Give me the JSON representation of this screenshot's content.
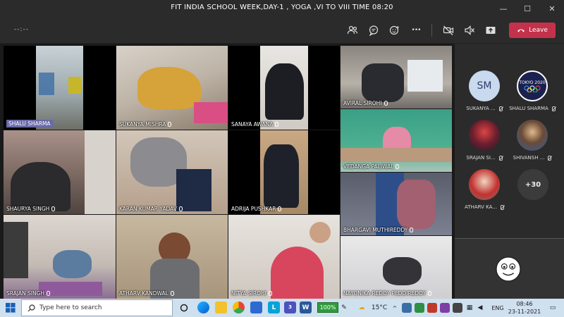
{
  "window": {
    "title": "FIT INDIA SCHOOL WEEK,DAY-1 , YOGA ,VI TO VIII TIME 08:20",
    "minimize_glyph": "—",
    "maximize_glyph": "☐",
    "close_glyph": "✕"
  },
  "toolbar": {
    "timer": "--:--",
    "leave_label": "Leave",
    "more_glyph": "•••",
    "icons": [
      "people-icon",
      "chat-icon",
      "reactions-icon",
      "more-icon",
      "camera-off-icon",
      "mic-off-icon",
      "share-icon",
      "phone-icon"
    ],
    "leave_color": "#c4314b"
  },
  "participants_grid": [
    {
      "name": "SHALU SHARMA",
      "boxed": true
    },
    {
      "name": "SUKANYA MISHRA"
    },
    {
      "name": "SANAYA AWANA"
    },
    {
      "name": "AVIRAL SIROHI"
    },
    {
      "name": "VEDANGA PALIWAL"
    },
    {
      "name": "SHAURYA SINGH"
    },
    {
      "name": "KARAN KUMAR YADAV"
    },
    {
      "name": "ADRIJA PUSHKAR"
    },
    {
      "name": "BHARGAVI MUTHIREDDY"
    },
    {
      "name": "SRAJAN SINGH"
    },
    {
      "name": "ATHARV KANDWAL"
    },
    {
      "name": "NITYA SIROHI"
    },
    {
      "name": "NAYONIKA REDDY PEDDIREDDY"
    }
  ],
  "roster": [
    {
      "name": "SUKANYA ...",
      "initials": "SM"
    },
    {
      "name": "SHALU SHARMA",
      "initials": "TOKYO 2020"
    },
    {
      "name": "SRAJAN SI...",
      "initials": ""
    },
    {
      "name": "SHIVANSH ...",
      "initials": ""
    },
    {
      "name": "ATHARV KA...",
      "initials": ""
    }
  ],
  "roster_more": "+30",
  "taskbar": {
    "search_placeholder": "Type here to search",
    "battery": "100%",
    "weather": "15°C",
    "language": "ENG",
    "time": "08:46",
    "date": "23-11-2021",
    "teams_badge": "3"
  }
}
